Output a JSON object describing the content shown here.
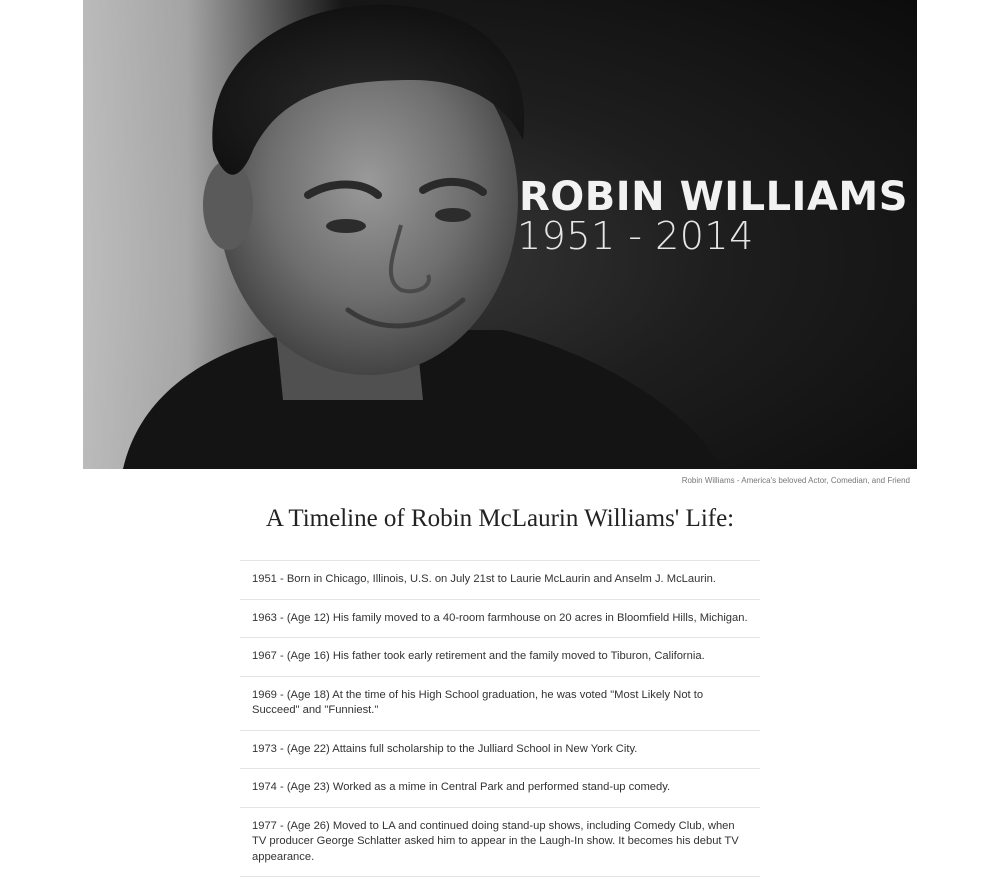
{
  "hero": {
    "name": "ROBIN WILLIAMS",
    "years": "1951 - 2014",
    "caption": "Robin Williams - America's beloved Actor, Comedian, and Friend"
  },
  "title": "A Timeline of Robin McLaurin Williams' Life:",
  "timeline": [
    "1951 - Born in Chicago, Illinois, U.S. on July 21st to Laurie McLaurin and Anselm J. McLaurin.",
    "1963 - (Age 12) His family moved to a 40-room farmhouse on 20 acres in Bloomfield Hills, Michigan.",
    "1967 - (Age 16) His father took early retirement and the family moved to Tiburon, California.",
    "1969 - (Age 18) At the time of his High School graduation, he was voted \"Most Likely Not to Succeed\" and \"Funniest.\"",
    "1973 - (Age 22) Attains full scholarship to the Julliard School in New York City.",
    "1974 - (Age 23) Worked as a mime in Central Park and performed stand-up comedy.",
    "1977 - (Age 26) Moved to LA and continued doing stand-up shows, including Comedy Club, when TV producer George Schlatter asked him to appear in the Laugh-In show. It becomes his debut TV appearance."
  ]
}
